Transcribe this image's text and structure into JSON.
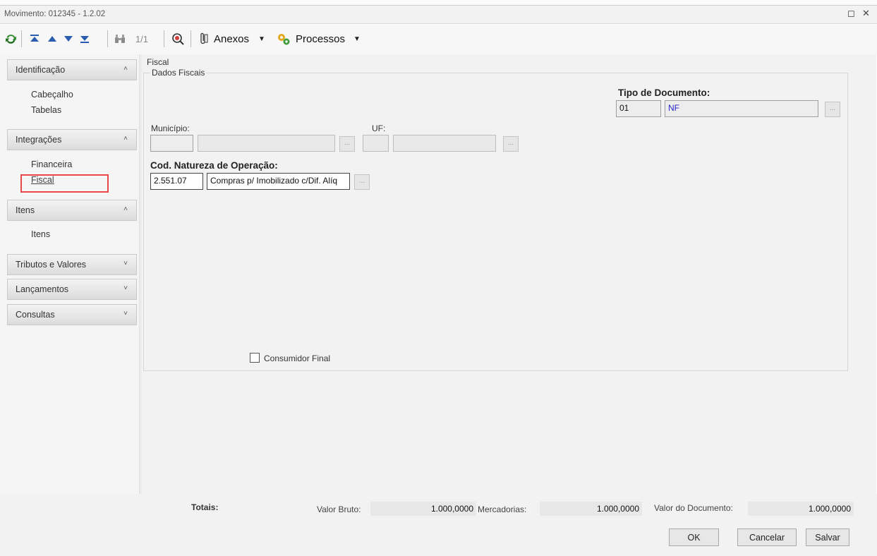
{
  "window": {
    "title": "Movimento: 012345 - 1.2.02",
    "restore_glyph": "◻",
    "close_glyph": "✕"
  },
  "toolbar": {
    "record_counter": "1/1",
    "attachments_label": "Anexos",
    "processes_label": "Processos",
    "dropdown_glyph": "▼"
  },
  "sidebar": {
    "groups": [
      {
        "label": "Identificação",
        "expanded": true,
        "items": [
          "Cabeçalho",
          "Tabelas"
        ]
      },
      {
        "label": "Integrações",
        "expanded": true,
        "items": [
          "Financeira",
          "Fiscal"
        ]
      },
      {
        "label": "Itens",
        "expanded": true,
        "items": [
          "Itens"
        ]
      },
      {
        "label": "Tributos e Valores",
        "expanded": false,
        "items": []
      },
      {
        "label": "Lançamentos",
        "expanded": false,
        "items": []
      },
      {
        "label": "Consultas",
        "expanded": false,
        "items": []
      }
    ],
    "selected_item": "Fiscal",
    "chevron_up": "˄",
    "chevron_down": "˅"
  },
  "page": {
    "title": "Fiscal",
    "group_title": "Dados Fiscais"
  },
  "form": {
    "tipo_documento": {
      "label": "Tipo de Documento:",
      "code": "01",
      "description": "NF"
    },
    "municipio": {
      "label": "Município:",
      "code": "",
      "name": ""
    },
    "uf": {
      "label": "UF:",
      "code": "",
      "name": ""
    },
    "natureza": {
      "label": "Cod. Natureza de Operação:",
      "code": "2.551.07",
      "description": "Compras p/ Imobilizado c/Dif. Alíq"
    },
    "consumidor_final": {
      "label": "Consumidor Final",
      "checked": false
    },
    "ellipsis": "..."
  },
  "totals": {
    "label": "Totais:",
    "valor_bruto_label": "Valor Bruto:",
    "valor_bruto": "1.000,0000",
    "mercadorias_label": "Mercadorias:",
    "mercadorias": "1.000,0000",
    "valor_documento_label": "Valor do Documento:",
    "valor_documento": "1.000,0000"
  },
  "buttons": {
    "ok": "OK",
    "cancel": "Cancelar",
    "save": "Salvar"
  },
  "colors": {
    "accent_red": "#e84848",
    "link_blue": "#2323c8"
  }
}
